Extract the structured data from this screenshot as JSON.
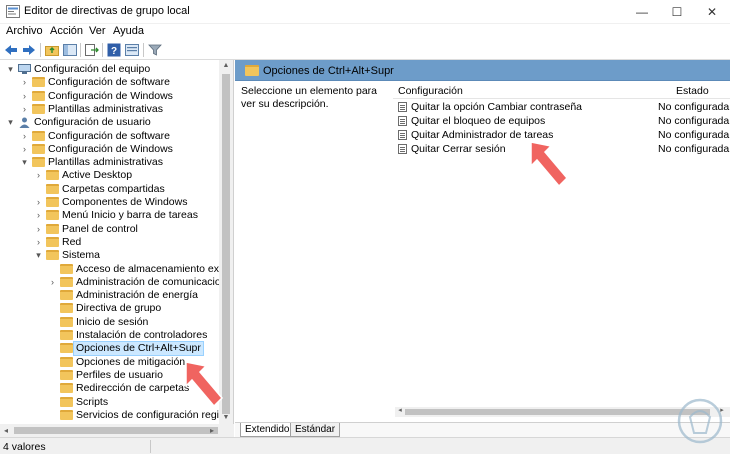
{
  "window": {
    "title": "Editor de directivas de grupo local",
    "minimize_glyph": "—",
    "maximize_glyph": "☐",
    "close_glyph": "✕"
  },
  "menu": [
    "Archivo",
    "Acción",
    "Ver",
    "Ayuda"
  ],
  "toolbar": {
    "icons": [
      "back-arrow-icon",
      "forward-arrow-icon",
      "up-folder-icon",
      "show-hide-tree-icon",
      "export-list-icon",
      "help-icon",
      "properties-icon",
      "filter-icon"
    ]
  },
  "tree": {
    "items": [
      {
        "label": "Configuración del equipo",
        "level": 0,
        "chevron": "▾",
        "icon": "computer-icon"
      },
      {
        "label": "Configuración de software",
        "level": 1,
        "chevron": "›",
        "icon": "folder-icon"
      },
      {
        "label": "Configuración de Windows",
        "level": 1,
        "chevron": "›",
        "icon": "folder-icon"
      },
      {
        "label": "Plantillas administrativas",
        "level": 1,
        "chevron": "›",
        "icon": "folder-icon"
      },
      {
        "label": "Configuración de usuario",
        "level": 0,
        "chevron": "▾",
        "icon": "user-icon"
      },
      {
        "label": "Configuración de software",
        "level": 1,
        "chevron": "›",
        "icon": "folder-icon"
      },
      {
        "label": "Configuración de Windows",
        "level": 1,
        "chevron": "›",
        "icon": "folder-icon"
      },
      {
        "label": "Plantillas administrativas",
        "level": 1,
        "chevron": "▾",
        "icon": "folder-icon"
      },
      {
        "label": "Active Desktop",
        "level": 2,
        "chevron": "›",
        "icon": "folder-icon"
      },
      {
        "label": "Carpetas compartidas",
        "level": 2,
        "chevron": "",
        "icon": "folder-icon"
      },
      {
        "label": "Componentes de Windows",
        "level": 2,
        "chevron": "›",
        "icon": "folder-icon"
      },
      {
        "label": "Menú Inicio y barra de tareas",
        "level": 2,
        "chevron": "›",
        "icon": "folder-icon"
      },
      {
        "label": "Panel de control",
        "level": 2,
        "chevron": "›",
        "icon": "folder-icon"
      },
      {
        "label": "Red",
        "level": 2,
        "chevron": "›",
        "icon": "folder-icon"
      },
      {
        "label": "Sistema",
        "level": 2,
        "chevron": "▾",
        "icon": "folder-icon"
      },
      {
        "label": "Acceso de almacenamiento extraíble",
        "level": 3,
        "chevron": "",
        "icon": "folder-icon"
      },
      {
        "label": "Administración de comunicaciones de Internet",
        "level": 3,
        "chevron": "›",
        "icon": "folder-icon"
      },
      {
        "label": "Administración de energía",
        "level": 3,
        "chevron": "",
        "icon": "folder-icon"
      },
      {
        "label": "Directiva de grupo",
        "level": 3,
        "chevron": "",
        "icon": "folder-icon"
      },
      {
        "label": "Inicio de sesión",
        "level": 3,
        "chevron": "",
        "icon": "folder-icon"
      },
      {
        "label": "Instalación de controladores",
        "level": 3,
        "chevron": "",
        "icon": "folder-icon"
      },
      {
        "label": "Opciones de Ctrl+Alt+Supr",
        "level": 3,
        "chevron": "",
        "icon": "folder-open-icon",
        "selected": true
      },
      {
        "label": "Opciones de mitigación",
        "level": 3,
        "chevron": "",
        "icon": "folder-icon"
      },
      {
        "label": "Perfiles de usuario",
        "level": 3,
        "chevron": "",
        "icon": "folder-icon"
      },
      {
        "label": "Redirección de carpetas",
        "level": 3,
        "chevron": "",
        "icon": "folder-icon"
      },
      {
        "label": "Scripts",
        "level": 3,
        "chevron": "",
        "icon": "folder-icon"
      },
      {
        "label": "Servicios de configuración regional",
        "level": 3,
        "chevron": "",
        "icon": "folder-icon"
      }
    ]
  },
  "detail": {
    "header": "Opciones de Ctrl+Alt+Supr",
    "description": "Seleccione un elemento para ver su descripción.",
    "columns": {
      "name": "Configuración",
      "state": "Estado"
    },
    "rows": [
      {
        "name": "Quitar la opción Cambiar contraseña",
        "state": "No configurada"
      },
      {
        "name": "Quitar el bloqueo de equipos",
        "state": "No configurada"
      },
      {
        "name": "Quitar Administrador de tareas",
        "state": "No configurada"
      },
      {
        "name": "Quitar Cerrar sesión",
        "state": "No configurada"
      }
    ],
    "tabs": [
      "Extendido",
      "Estándar"
    ]
  },
  "status": {
    "text": "4 valores"
  },
  "colors": {
    "header_blue": "#6d9cc9",
    "selection": "#cce8ff",
    "folder": "#f2c55c",
    "annotation_arrow": "#f06460"
  }
}
